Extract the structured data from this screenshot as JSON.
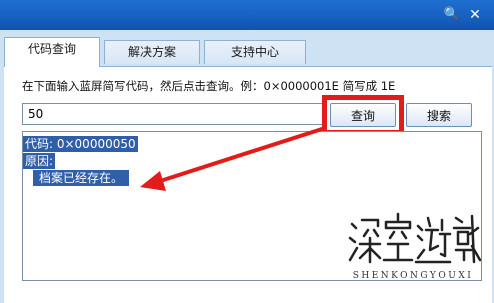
{
  "tabs": [
    {
      "label": "代码查询",
      "active": true
    },
    {
      "label": "解决方案",
      "active": false
    },
    {
      "label": "支持中心",
      "active": false
    }
  ],
  "query": {
    "instruction": "在下面输入蓝屏简写代码，然后点击查询。例：0×0000001E 简写成 1E",
    "code_value": "50",
    "query_button": "查询",
    "search_button": "搜索"
  },
  "result": {
    "code_line": "代码: 0×00000050",
    "reason_label": "原因:",
    "reason_text": "档案已经存在。"
  },
  "watermark": {
    "logo_text": "SHENKONGYOUXI"
  },
  "colors": {
    "titlebar": "#1761c2",
    "highlight": "#e21b1b",
    "selection": "#2f5fa9"
  }
}
